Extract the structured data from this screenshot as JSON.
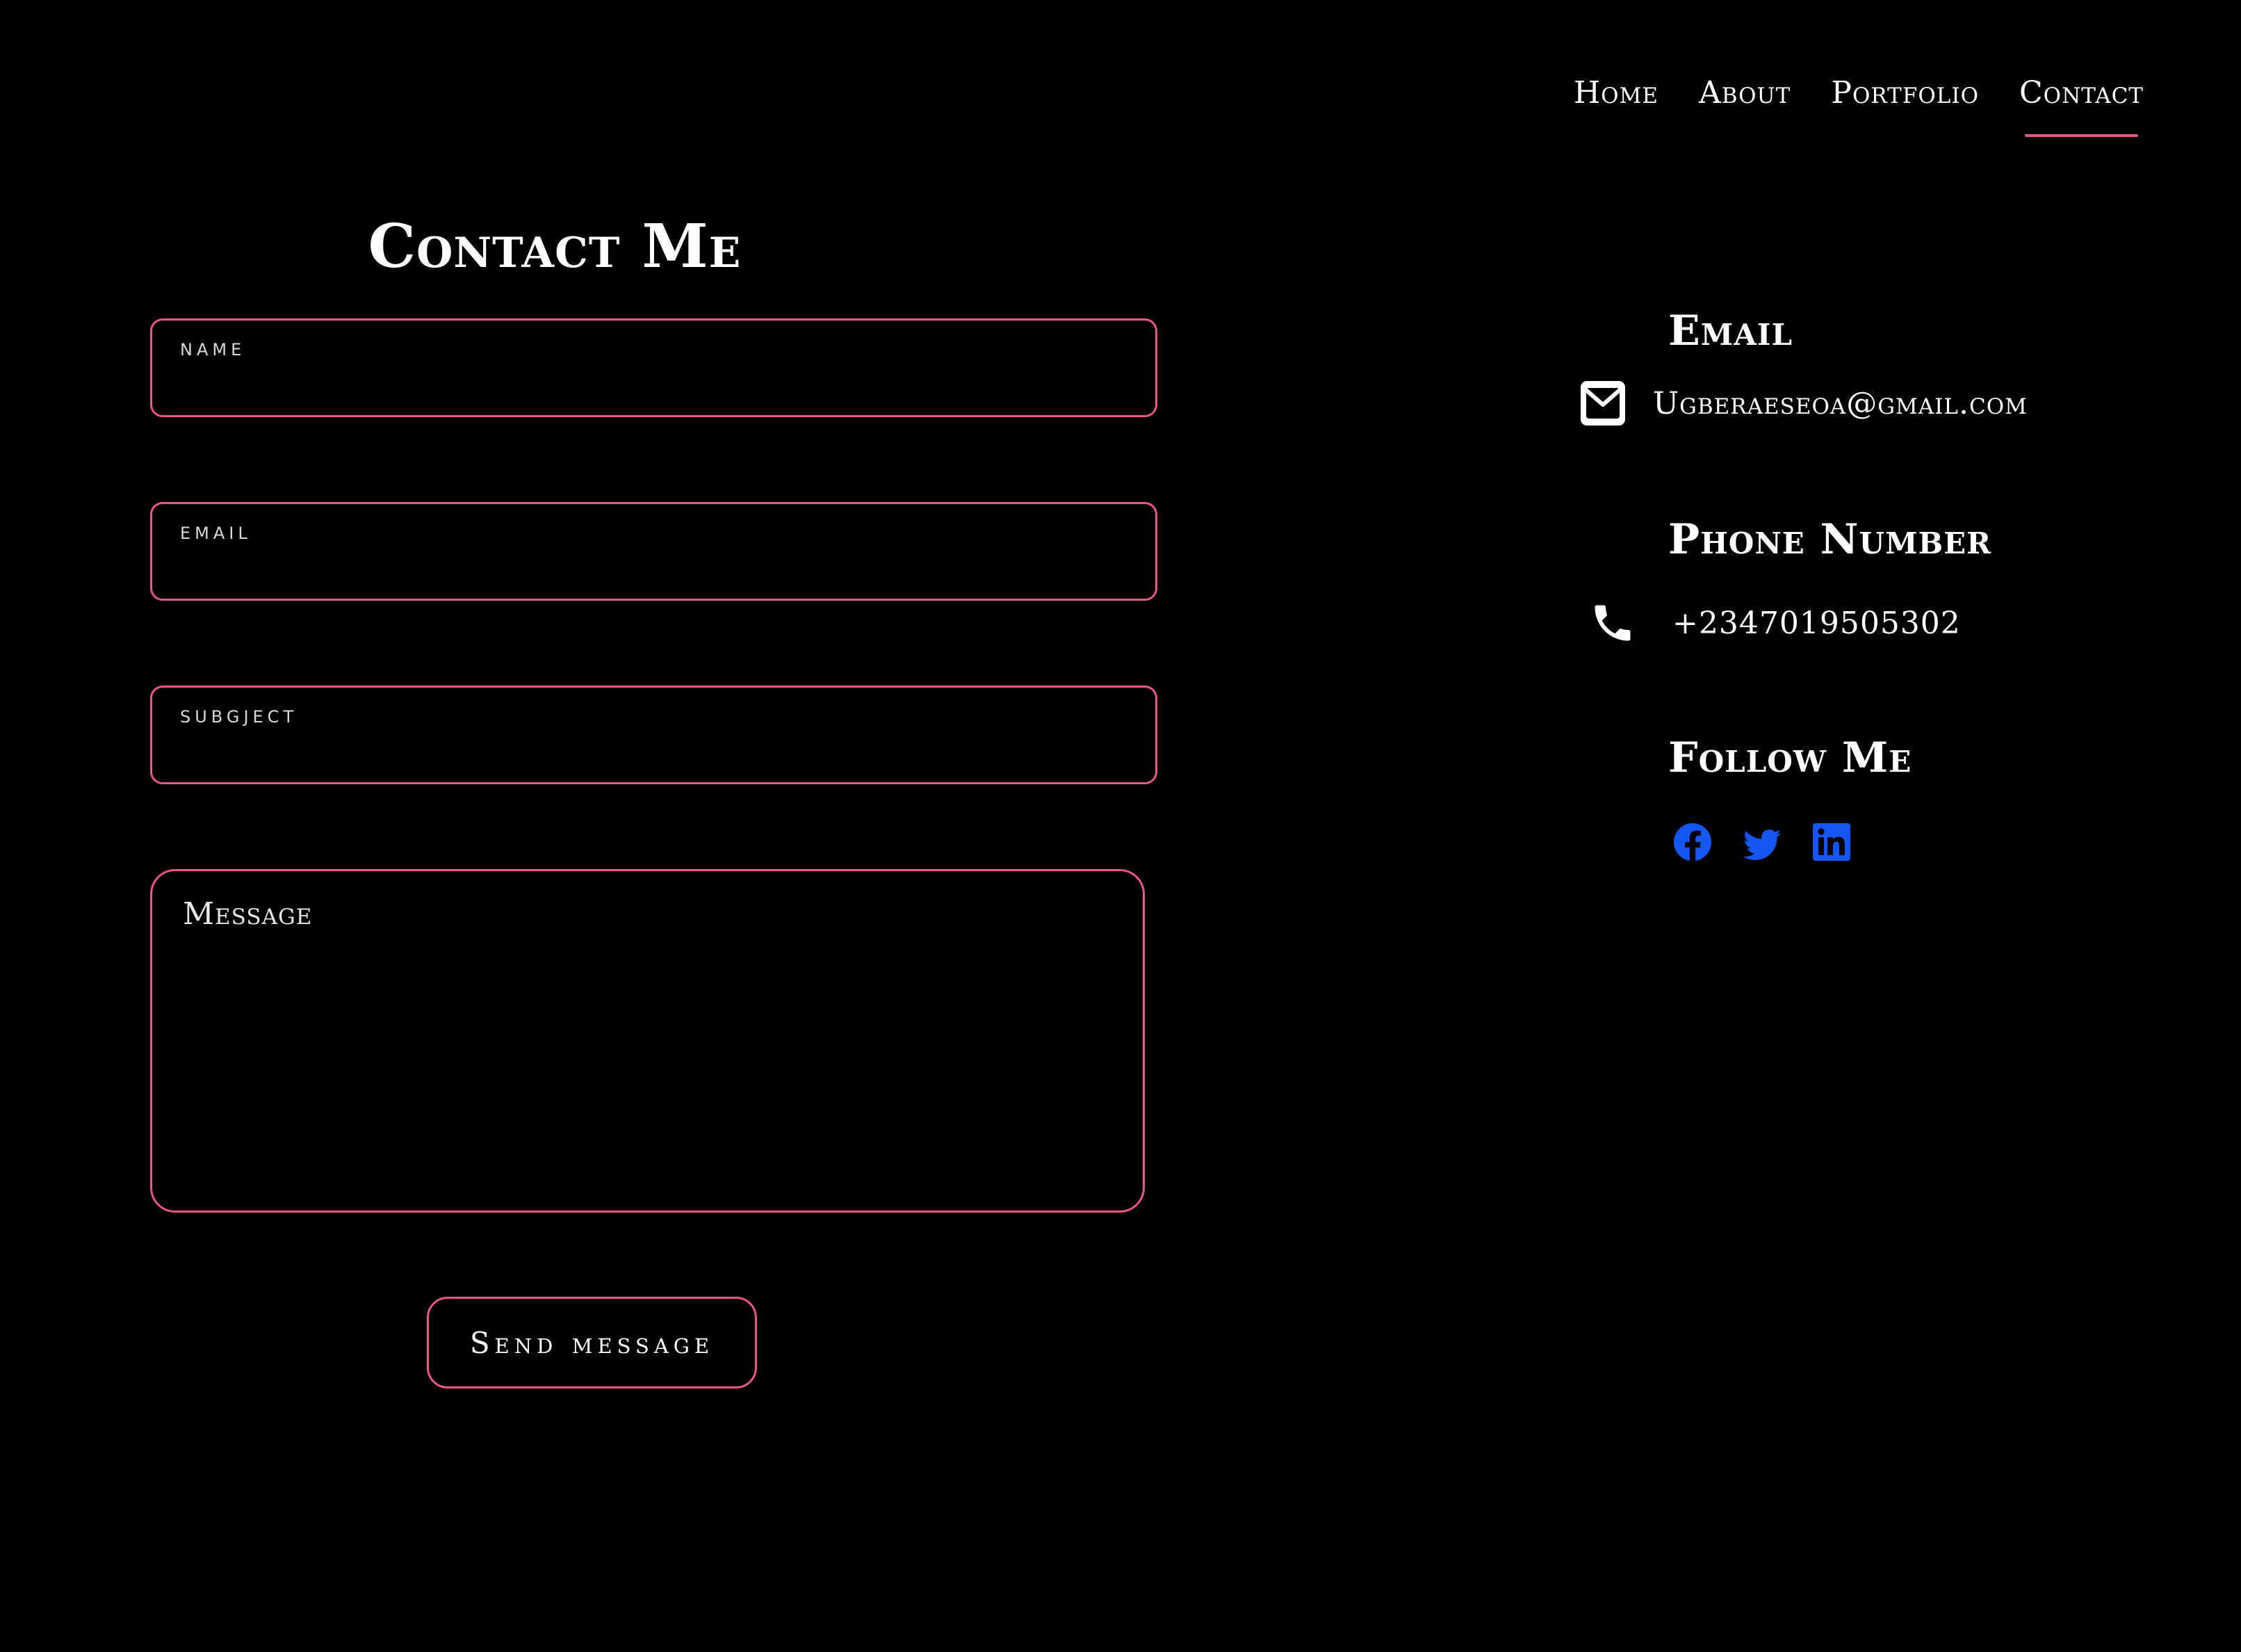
{
  "nav": {
    "items": [
      {
        "label": "Home"
      },
      {
        "label": "About"
      },
      {
        "label": "Portfolio"
      },
      {
        "label": "Contact",
        "active": true
      }
    ]
  },
  "form": {
    "title": "Contact Me",
    "fields": {
      "name_label": "name",
      "name_value": "",
      "email_label": "email",
      "email_value": "",
      "subject_label": "subgject",
      "subject_value": ""
    },
    "message_placeholder": "Message",
    "send_label": "Send message"
  },
  "contact_info": {
    "email_heading": "Email",
    "email_value": "Ugberaeseoa@gmail.com",
    "phone_heading": "Phone Number",
    "phone_value": "+2347019505302",
    "follow_heading": "Follow Me"
  },
  "icons": {
    "email": "envelope-icon",
    "phone": "phone-icon",
    "social": [
      "facebook-icon",
      "twitter-icon",
      "linkedin-icon"
    ]
  },
  "colors": {
    "background": "#000000",
    "accent": "#e9558d",
    "text": "#ffffff",
    "social": "#1557f4"
  }
}
